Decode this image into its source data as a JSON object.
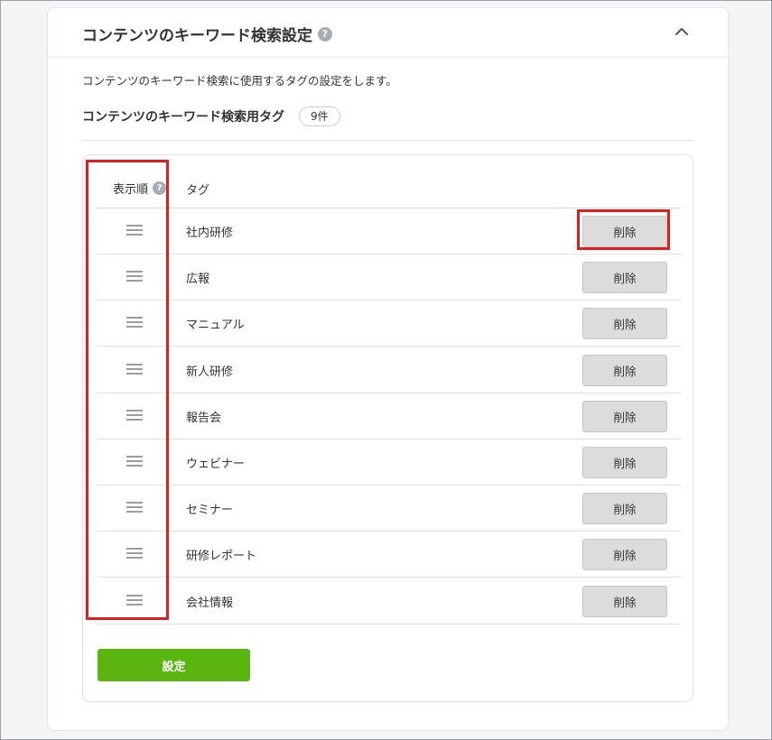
{
  "section": {
    "title": "コンテンツのキーワード検索設定",
    "help_icon": "question-circle-icon",
    "collapse_icon": "chevron-up-icon",
    "description": "コンテンツのキーワード検索に使用するタグの設定をします。",
    "subtitle": "コンテンツのキーワード検索用タグ",
    "count": "9件"
  },
  "table": {
    "header_order": "表示順",
    "header_tag": "タグ",
    "delete_label": "削除",
    "drag_icon": "drag-handle-icon",
    "rows": [
      {
        "tag": "社内研修"
      },
      {
        "tag": "広報"
      },
      {
        "tag": "マニュアル"
      },
      {
        "tag": "新人研修"
      },
      {
        "tag": "報告会"
      },
      {
        "tag": "ウェビナー"
      },
      {
        "tag": "セミナー"
      },
      {
        "tag": "研修レポート"
      },
      {
        "tag": "会社情報"
      }
    ]
  },
  "submit_label": "設定",
  "colors": {
    "primary_button": "#5bb50f",
    "highlight": "#e01e1e",
    "delete_button": "#dcdcdc"
  }
}
